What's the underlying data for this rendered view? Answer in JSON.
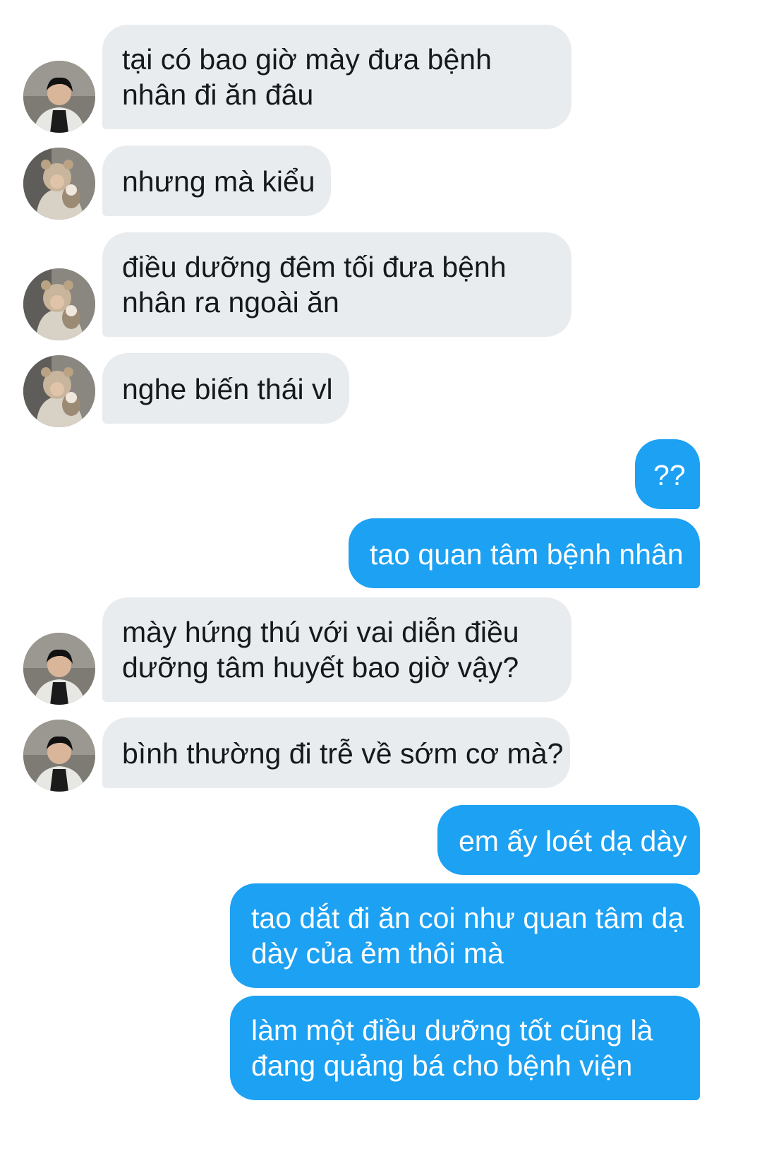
{
  "conversation": {
    "messages": [
      {
        "side": "incoming",
        "avatar": "avatar-boy-black-shirt",
        "lines": [
          "tại có bao giờ mày đưa bệnh",
          "nhân đi ăn đâu"
        ]
      },
      {
        "side": "incoming",
        "avatar": "avatar-bear-hat-dog",
        "lines": [
          "nhưng mà kiểu"
        ]
      },
      {
        "side": "incoming",
        "avatar": "avatar-bear-hat-dog",
        "lines": [
          "điều dưỡng đêm tối đưa bệnh",
          "nhân ra ngoài ăn"
        ]
      },
      {
        "side": "incoming",
        "avatar": "avatar-bear-hat-dog",
        "lines": [
          "nghe biến thái vl"
        ]
      },
      {
        "side": "outgoing",
        "lines": [
          "??"
        ]
      },
      {
        "side": "outgoing",
        "lines": [
          "tao quan tâm bệnh nhân"
        ]
      },
      {
        "side": "incoming",
        "avatar": "avatar-boy-black-shirt",
        "lines": [
          "mày hứng thú với vai diễn điều",
          "dưỡng tâm huyết bao giờ vậy?"
        ]
      },
      {
        "side": "incoming",
        "avatar": "avatar-boy-black-shirt",
        "lines": [
          "bình thường đi trễ về sớm cơ mà?"
        ]
      },
      {
        "side": "outgoing",
        "lines": [
          "em ấy loét dạ dày"
        ]
      },
      {
        "side": "outgoing",
        "lines": [
          "tao dắt đi ăn coi như quan tâm dạ",
          "dày của ẻm thôi mà"
        ]
      },
      {
        "side": "outgoing",
        "lines": [
          "làm một điều dưỡng tốt cũng là",
          "đang quảng bá cho bệnh viện"
        ]
      }
    ]
  },
  "colors": {
    "incoming_bubble": "#e9ecef",
    "outgoing_bubble": "#1da1f2",
    "incoming_text": "#15181c",
    "outgoing_text": "#ffffff"
  }
}
